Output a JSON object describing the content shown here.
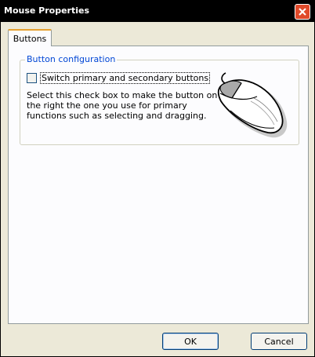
{
  "window": {
    "title": "Mouse Properties",
    "close_icon": "close-icon"
  },
  "tabs": [
    {
      "label": "Buttons",
      "selected": true
    }
  ],
  "button_config": {
    "group_label": "Button configuration",
    "checkbox_label": "Switch primary and secondary buttons",
    "checked": false,
    "description": "Select this check box to make the button on the right the one you use for primary functions such as selecting and dragging.",
    "image_icon": "mouse-icon"
  },
  "footer": {
    "ok_label": "OK",
    "cancel_label": "Cancel"
  },
  "colors": {
    "titlebar": "#000000",
    "group_label": "#0046d5",
    "tab_accent": "#e6a130",
    "close_button": "#e04a2a"
  }
}
